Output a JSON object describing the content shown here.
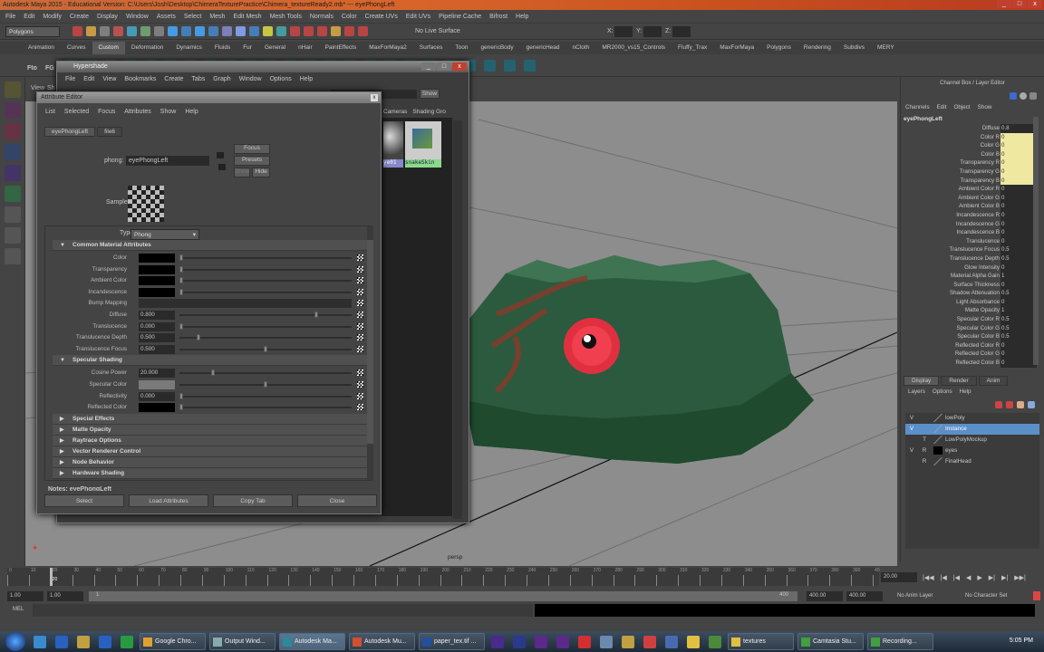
{
  "app": {
    "title": "Autodesk Maya 2015 - Educational Version: C:\\Users\\Josh\\Desktop\\ChimeraTexturePractice\\Chimera_textureReady2.mb*  ---  eyePhongLeft",
    "menus": [
      "File",
      "Edit",
      "Modify",
      "Create",
      "Display",
      "Window",
      "Assets",
      "Select",
      "Mesh",
      "Edit Mesh",
      "Mesh Tools",
      "Normals",
      "Color",
      "Create UVs",
      "Edit UVs",
      "Pipeline Cache",
      "Bifrost",
      "Help"
    ]
  },
  "status": {
    "menuset": "Polygons",
    "live_surface": "No Live Surface",
    "x_label": "X:",
    "y_label": "Y:",
    "z_label": "Z:"
  },
  "shelf": {
    "tabs": [
      "Animation",
      "Curves",
      "Custom",
      "Deformation",
      "Dynamics",
      "Fluids",
      "Fur",
      "General",
      "nHair",
      "PaintEffects",
      "MaxForMaya2",
      "Surfaces",
      "Toon",
      "genericBody",
      "genericHead",
      "nCloth",
      "MR2000_vs15_Controls",
      "Fluffy_Trax",
      "MaxForMaya",
      "Polygons",
      "Rendering",
      "Subdivs",
      "MERY"
    ],
    "active": "Custom",
    "labels": [
      "Fto",
      "FG"
    ]
  },
  "viewport": {
    "menus": [
      "View",
      "Sh"
    ],
    "camera": "persp",
    "colors": {
      "bg": "#8d8d8d",
      "skin": "#2c5a3e",
      "eye": "#e03040"
    }
  },
  "hypershade": {
    "title": "Hypershade",
    "menus": [
      "File",
      "Edit",
      "View",
      "Bookmarks",
      "Create",
      "Tabs",
      "Graph",
      "Window",
      "Options",
      "Help"
    ],
    "show_button": "Show",
    "tabs": [
      "Cameras",
      "Shading Gro"
    ],
    "swatches": [
      "ye01",
      "snakeSkin"
    ]
  },
  "attribute_editor": {
    "title": "Attribute Editor",
    "menus": [
      "List",
      "Selected",
      "Focus",
      "Attributes",
      "Show",
      "Help"
    ],
    "tabs": [
      "eyePhongLeft",
      "file6"
    ],
    "node_type_label": "phong:",
    "node_name": "eyePhongLeft",
    "focus": "Focus",
    "presets": "Presets",
    "show": "Show",
    "hide": "Hide",
    "sample_label": "Sample",
    "type_label": "Type",
    "type_value": "Phong",
    "section_common": "Common Material Attributes",
    "common": [
      {
        "label": "Color",
        "kind": "swatch",
        "color": "#000000",
        "slider": 0
      },
      {
        "label": "Transparency",
        "kind": "swatch",
        "color": "#000000",
        "slider": 0
      },
      {
        "label": "Ambient Color",
        "kind": "swatch",
        "color": "#000000",
        "slider": 0
      },
      {
        "label": "Incandescence",
        "kind": "swatch",
        "color": "#000000",
        "slider": 0
      },
      {
        "label": "Bump Mapping",
        "kind": "bump"
      },
      {
        "label": "Diffuse",
        "kind": "value",
        "value": "0.800",
        "slider": 0.8
      },
      {
        "label": "Translucence",
        "kind": "value",
        "value": "0.000",
        "slider": 0
      },
      {
        "label": "Translucence Depth",
        "kind": "value",
        "value": "0.500",
        "slider": 0.1
      },
      {
        "label": "Translucence Focus",
        "kind": "value",
        "value": "0.500",
        "slider": 0.5
      }
    ],
    "section_specular": "Specular Shading",
    "specular": [
      {
        "label": "Cosine Power",
        "kind": "value",
        "value": "20.000",
        "slider": 0.19
      },
      {
        "label": "Specular Color",
        "kind": "swatch",
        "color": "#7a7a7a",
        "slider": 0.5
      },
      {
        "label": "Reflectivity",
        "kind": "value",
        "value": "0.000",
        "slider": 0
      },
      {
        "label": "Reflected Color",
        "kind": "swatch",
        "color": "#000000",
        "slider": 0
      }
    ],
    "collapsed": [
      "Special Effects",
      "Matte Opacity",
      "Raytrace Options",
      "Vector Renderer Control",
      "Node Behavior",
      "Hardware Shading"
    ],
    "notes": "Notes: eyePhongLeft",
    "buttons": [
      "Select",
      "Load Attributes",
      "Copy Tab",
      "Close"
    ]
  },
  "channel_box": {
    "title": "Channel Box / Layer Editor",
    "menus": [
      "Channels",
      "Edit",
      "Object",
      "Show"
    ],
    "node": "eyePhongLeft",
    "rows": [
      [
        "Diffuse",
        "0.8",
        0
      ],
      [
        "Color R",
        "0",
        1
      ],
      [
        "Color G",
        "0",
        1
      ],
      [
        "Color B",
        "0",
        1
      ],
      [
        "Transparency R",
        "0",
        1
      ],
      [
        "Transparency G",
        "0",
        1
      ],
      [
        "Transparency B",
        "0",
        1
      ],
      [
        "Ambient Color R",
        "0",
        0
      ],
      [
        "Ambient Color G",
        "0",
        0
      ],
      [
        "Ambient Color B",
        "0",
        0
      ],
      [
        "Incandescence R",
        "0",
        0
      ],
      [
        "Incandescence G",
        "0",
        0
      ],
      [
        "Incandescence B",
        "0",
        0
      ],
      [
        "Translucence",
        "0",
        0
      ],
      [
        "Translucence Focus",
        "0.5",
        0
      ],
      [
        "Translucence Depth",
        "0.5",
        0
      ],
      [
        "Glow Intensity",
        "0",
        0
      ],
      [
        "Material Alpha Gain",
        "1",
        0
      ],
      [
        "Surface Thickness",
        "0",
        0
      ],
      [
        "Shadow Attenuation",
        "0.5",
        0
      ],
      [
        "Light Absorbance",
        "0",
        0
      ],
      [
        "Matte Opacity",
        "1",
        0
      ],
      [
        "Specular Color R",
        "0.5",
        0
      ],
      [
        "Specular Color G",
        "0.5",
        0
      ],
      [
        "Specular Color B",
        "0.5",
        0
      ],
      [
        "Reflected Color R",
        "0",
        0
      ],
      [
        "Reflected Color G",
        "0",
        0
      ],
      [
        "Reflected Color B",
        "0",
        0
      ]
    ]
  },
  "layer_editor": {
    "tabs": [
      "Display",
      "Render",
      "Anim"
    ],
    "menus": [
      "Layers",
      "Options",
      "Help"
    ],
    "layers": [
      {
        "v": "V",
        "p": "",
        "name": "lowPoly",
        "sel": false,
        "color": ""
      },
      {
        "v": "V",
        "p": "",
        "name": "Instance",
        "sel": true,
        "color": ""
      },
      {
        "v": "",
        "p": "T",
        "name": "LowPolyMockup",
        "sel": false,
        "color": ""
      },
      {
        "v": "V",
        "p": "R",
        "name": "eyes",
        "sel": false,
        "color": "#000000"
      },
      {
        "v": "",
        "p": "R",
        "name": "FinalHead",
        "sel": false,
        "color": ""
      }
    ]
  },
  "timeline": {
    "ticks": [
      "0",
      "10",
      "20",
      "30",
      "40",
      "50",
      "60",
      "70",
      "80",
      "90",
      "100",
      "110",
      "120",
      "130",
      "140",
      "150",
      "160",
      "170",
      "180",
      "190",
      "200",
      "210",
      "220",
      "230",
      "240",
      "250",
      "260",
      "270",
      "280",
      "290",
      "300",
      "310",
      "320",
      "330",
      "340",
      "350",
      "360",
      "370",
      "380",
      "390",
      "40"
    ],
    "current_frame": "20",
    "current_time": "20.00",
    "start": 0,
    "end": 400
  },
  "range": {
    "start": "1.00",
    "start2": "1.00",
    "slider_start": "1",
    "slider_end": "400",
    "end": "400.00",
    "end2": "400.00",
    "anim_layer": "No Anim Layer",
    "char_set": "No Character Set"
  },
  "command": {
    "label": "MEL"
  },
  "taskbar": {
    "items": [
      {
        "label": "Google Chro...",
        "color": "#e0a030",
        "active": false
      },
      {
        "label": "Output Wind...",
        "color": "#8aa",
        "active": false
      },
      {
        "label": "Autodesk Ma...",
        "color": "#2a8a9a",
        "active": true
      },
      {
        "label": "Autodesk Mu...",
        "color": "#d05030",
        "active": false
      },
      {
        "label": "paper_tex.tif ...",
        "color": "#2050a0",
        "active": false
      },
      {
        "label": "textures",
        "color": "#e0c040",
        "active": false
      },
      {
        "label": "Camtasia Stu...",
        "color": "#40a040",
        "active": false
      },
      {
        "label": "Recording...",
        "color": "#40a040",
        "active": false
      }
    ],
    "clock": "5:05 PM"
  }
}
